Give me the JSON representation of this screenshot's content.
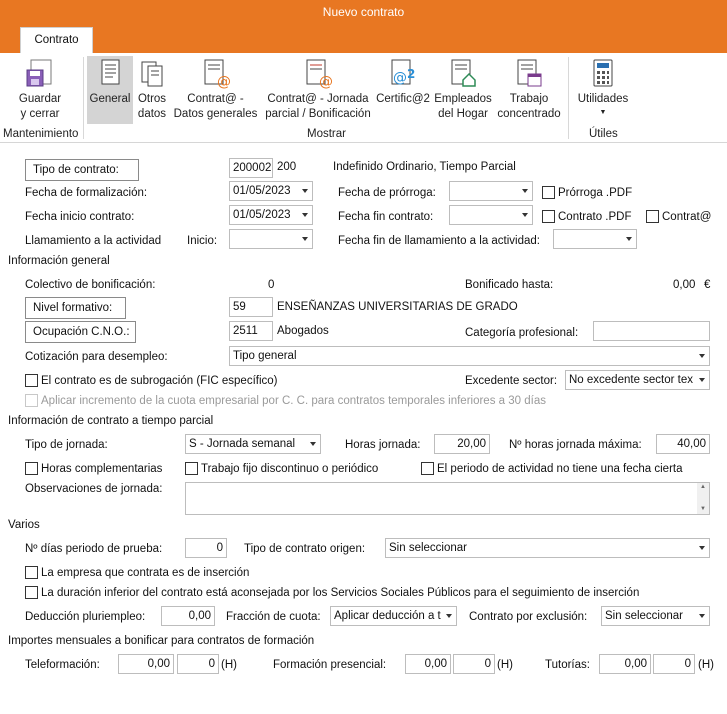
{
  "window": {
    "title": "Nuevo contrato"
  },
  "tabs": {
    "active": "Contrato"
  },
  "ribbon": {
    "mantenimiento": {
      "group": "Mantenimiento",
      "guardar_1": "Guardar",
      "guardar_2": "y cerrar"
    },
    "mostrar": {
      "group": "Mostrar",
      "general": "General",
      "otros_1": "Otros",
      "otros_2": "datos",
      "contrata1_1": "Contrat@ -",
      "contrata1_2": "Datos generales",
      "contrata2_1": "Contrat@ - Jornada",
      "contrata2_2": "parcial / Bonificación",
      "certific_1": "Certific@2",
      "empleados_1": "Empleados",
      "empleados_2": "del Hogar",
      "trabajo_1": "Trabajo",
      "trabajo_2": "concentrado"
    },
    "utiles": {
      "group": "Útiles",
      "utilidades": "Utilidades"
    }
  },
  "contrato": {
    "tipo_btn": "Tipo de contrato:",
    "tipo_code": "200002",
    "tipo_sub": "200",
    "tipo_desc": "Indefinido Ordinario, Tiempo Parcial",
    "fecha_formalizacion_label": "Fecha de formalización:",
    "fecha_formalizacion": "01/05/2023",
    "fecha_prorroga_label": "Fecha de prórroga:",
    "fecha_prorroga": "",
    "prorroga_pdf": "Prórroga .PDF",
    "fecha_inicio_label": "Fecha inicio contrato:",
    "fecha_inicio": "01/05/2023",
    "fecha_fin_label": "Fecha fin contrato:",
    "fecha_fin": "",
    "contrato_pdf": "Contrato .PDF",
    "contrata_chk": "Contrat@",
    "llamamiento_label": "Llamamiento a la actividad",
    "inicio_label": "Inicio:",
    "inicio": "",
    "fin_llamamiento_label": "Fecha fin de llamamiento a la actividad:",
    "fin_llamamiento": ""
  },
  "general": {
    "section": "Información general",
    "colectivo_label": "Colectivo de bonificación:",
    "colectivo_value": "0",
    "bonificado_label": "Bonificado hasta:",
    "bonificado_value": "0,00",
    "bonificado_unit": "€",
    "nivel_btn": "Nivel formativo:",
    "nivel_code": "59",
    "nivel_desc": "ENSEÑANZAS UNIVERSITARIAS DE GRADO",
    "ocupacion_btn": "Ocupación C.N.O.:",
    "ocupacion_code": "2511",
    "ocupacion_desc": "Abogados",
    "categoria_label": "Categoría profesional:",
    "categoria": "",
    "cotizacion_label": "Cotización para desempleo:",
    "cotizacion": "Tipo general",
    "subrogacion": "El contrato es de subrogación (FIC específico)",
    "excedente_label": "Excedente sector:",
    "excedente": "No excedente sector tex",
    "incremento": "Aplicar incremento de la cuota empresarial por C. C. para contratos temporales inferiores a 30 días"
  },
  "parcial": {
    "section": "Información de contrato a tiempo parcial",
    "tipo_jornada_label": "Tipo de jornada:",
    "tipo_jornada": "S - Jornada semanal",
    "horas_label": "Horas jornada:",
    "horas": "20,00",
    "horas_max_label": "Nº horas jornada máxima:",
    "horas_max": "40,00",
    "complementarias": "Horas complementarias",
    "fijo_discontinuo": "Trabajo fijo discontinuo o periódico",
    "periodo": "El periodo de actividad no tiene una fecha cierta",
    "observaciones_label": "Observaciones de jornada:",
    "observaciones": ""
  },
  "varios": {
    "section": "Varios",
    "prueba_label": "Nº días periodo de prueba:",
    "prueba": "0",
    "origen_label": "Tipo de contrato origen:",
    "origen": "Sin seleccionar",
    "insercion": "La empresa que contrata es de inserción",
    "duracion": "La duración inferior del contrato está aconsejada por los Servicios Sociales Públicos para el seguimiento de inserción",
    "deduccion_label": "Deducción pluriempleo:",
    "deduccion": "0,00",
    "fraccion_label": "Fracción de cuota:",
    "fraccion": "Aplicar deducción a t",
    "exclusion_label": "Contrato por exclusión:",
    "exclusion": "Sin seleccionar"
  },
  "formacion": {
    "section": "Importes mensuales a bonificar para contratos de formación",
    "tele_label": "Teleformación:",
    "tele_amount": "0,00",
    "tele_hours": "0",
    "pres_label": "Formación presencial:",
    "pres_amount": "0,00",
    "pres_hours": "0",
    "tut_label": "Tutorías:",
    "tut_amount": "0,00",
    "tut_hours": "0",
    "h": "(H)"
  },
  "colors": {
    "accent": "#e87722",
    "selected_bg": "#d4d4d4"
  }
}
